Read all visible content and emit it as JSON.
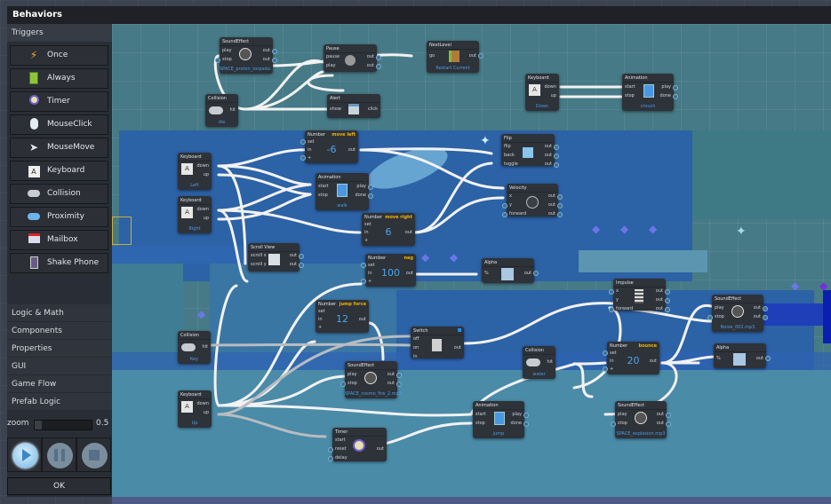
{
  "window": {
    "title": "Behaviors"
  },
  "sidebar": {
    "section_title": "Triggers",
    "triggers": [
      {
        "label": "Once",
        "icon": "lightning-icon"
      },
      {
        "label": "Always",
        "icon": "battery-icon"
      },
      {
        "label": "Timer",
        "icon": "alarm-clock-icon"
      },
      {
        "label": "MouseClick",
        "icon": "mouse-icon"
      },
      {
        "label": "MouseMove",
        "icon": "cursor-icon"
      },
      {
        "label": "Keyboard",
        "icon": "keyboard-key-icon"
      },
      {
        "label": "Collision",
        "icon": "collision-icon"
      },
      {
        "label": "Proximity",
        "icon": "proximity-icon"
      },
      {
        "label": "Mailbox",
        "icon": "mailbox-icon"
      },
      {
        "label": "Shake Phone",
        "icon": "phone-icon"
      }
    ],
    "categories": [
      "Logic & Math",
      "Components",
      "Properties",
      "GUI",
      "Game Flow",
      "Prefab Logic"
    ],
    "zoom": {
      "label": "zoom",
      "value": "0.5"
    },
    "playback": {
      "play": "play",
      "pause": "pause",
      "stop": "stop"
    },
    "ok_label": "OK"
  },
  "nodes": {
    "sfx_top": {
      "title": "SoundEffect",
      "ports_in": [
        "play",
        "stop"
      ],
      "ports_out": [
        "out",
        "out"
      ],
      "sub": "SPACE_proton_torpedo..."
    },
    "pause": {
      "title": "Pause",
      "ports_in": [
        "pause",
        "play"
      ],
      "ports_out": [
        "out",
        "out"
      ]
    },
    "next_level": {
      "title": "NextLevel",
      "ports_in": [
        "go"
      ],
      "ports_out": [
        "out"
      ],
      "sub": "Restart Current"
    },
    "collision_die": {
      "title": "Collision",
      "ports_out": [
        "hit"
      ],
      "sub": "die"
    },
    "alert": {
      "title": "Alert",
      "ports_in": [
        "show"
      ],
      "ports_out": [
        "click"
      ]
    },
    "kb_down": {
      "title": "Keyboard",
      "ports_out": [
        "down",
        "up"
      ],
      "sub": "Down"
    },
    "anim_crouch": {
      "title": "Animation",
      "ports_in": [
        "start",
        "stop"
      ],
      "ports_out": [
        "play",
        "done"
      ],
      "sub": "crouch"
    },
    "num_left": {
      "title": "Number",
      "hint": "move left",
      "ports_in": [
        "set",
        "in",
        "+"
      ],
      "ports_out": [
        "out"
      ],
      "value": "-6"
    },
    "flip": {
      "title": "Flip",
      "ports_in": [
        "flip",
        "back",
        "toggle"
      ],
      "ports_out": [
        "out",
        "out",
        "out"
      ]
    },
    "kb_left": {
      "title": "Keyboard",
      "ports_out": [
        "down",
        "up"
      ],
      "sub": "Left"
    },
    "anim_walk": {
      "title": "Animation",
      "ports_in": [
        "start",
        "stop"
      ],
      "ports_out": [
        "play",
        "done"
      ],
      "sub": "walk"
    },
    "velocity": {
      "title": "Velocity",
      "ports_in": [
        "x",
        "y",
        "forward"
      ],
      "ports_out": [
        "out",
        "out",
        "out"
      ]
    },
    "kb_right": {
      "title": "Keyboard",
      "ports_out": [
        "down",
        "up"
      ],
      "sub": "Right"
    },
    "num_right": {
      "title": "Number",
      "hint": "move right",
      "ports_in": [
        "set",
        "in",
        "+"
      ],
      "ports_out": [
        "out"
      ],
      "value": "6"
    },
    "scroll_view": {
      "title": "Scroll View",
      "ports_in": [
        "scroll x",
        "scroll y"
      ],
      "ports_out": [
        "out",
        "out"
      ]
    },
    "num_neg": {
      "title": "Number",
      "hint": "neg",
      "ports_in": [
        "set",
        "in",
        "+"
      ],
      "ports_out": [
        "out"
      ],
      "value": "100"
    },
    "alpha_top": {
      "title": "Alpha",
      "ports_in": [
        "%"
      ],
      "ports_out": [
        "out"
      ]
    },
    "impulse": {
      "title": "Impulse",
      "ports_in": [
        "x",
        "y",
        "forward"
      ],
      "ports_out": [
        "out",
        "out",
        "out"
      ]
    },
    "sfx_noise": {
      "title": "SoundEffect",
      "ports_in": [
        "play",
        "stop"
      ],
      "ports_out": [
        "out",
        "out"
      ],
      "sub": "Noise_002.mp3"
    },
    "num_jump": {
      "title": "Number",
      "hint": "jump force",
      "ports_in": [
        "set",
        "in",
        "+"
      ],
      "ports_out": [
        "out"
      ],
      "value": "12"
    },
    "collision_key": {
      "title": "Collision",
      "ports_out": [
        "hit"
      ],
      "sub": "Key"
    },
    "switch": {
      "title": "Switch",
      "ports_in": [
        "off",
        "on",
        "in"
      ],
      "ports_out": [
        "out"
      ]
    },
    "collision_water": {
      "title": "Collision",
      "ports_out": [
        "hit"
      ],
      "sub": "water"
    },
    "num_bounce": {
      "title": "Number",
      "hint": "bounce",
      "ports_in": [
        "set",
        "in",
        "+"
      ],
      "ports_out": [
        "out"
      ],
      "value": "20"
    },
    "alpha_bottom": {
      "title": "Alpha",
      "ports_in": [
        "%"
      ],
      "ports_out": [
        "out"
      ]
    },
    "sfx_cosmo": {
      "title": "SoundEffect",
      "ports_in": [
        "play",
        "stop"
      ],
      "ports_out": [
        "out",
        "out"
      ],
      "sub": "SPACE_cosmo_fire_2.mp3"
    },
    "kb_up": {
      "title": "Keyboard",
      "ports_out": [
        "down",
        "up"
      ],
      "sub": "Up"
    },
    "anim_jump": {
      "title": "Animation",
      "ports_in": [
        "start",
        "stop"
      ],
      "ports_out": [
        "play",
        "done"
      ],
      "sub": "jump"
    },
    "sfx_explosion": {
      "title": "SoundEffect",
      "ports_in": [
        "play",
        "stop"
      ],
      "ports_out": [
        "out",
        "out"
      ],
      "sub": "SPACE_explosion.mp3"
    },
    "timer": {
      "title": "Timer",
      "ports_in": [
        "start",
        "reset",
        "delay"
      ],
      "ports_out": [
        "out"
      ]
    }
  },
  "colors": {
    "canvas_bg": "#467a86",
    "level_blue": "#2c62a6",
    "node_bg": "#2e3239",
    "accent_blue": "#4a9ee6",
    "hint_orange": "#f0b400",
    "wire": "#f2f2f2"
  }
}
